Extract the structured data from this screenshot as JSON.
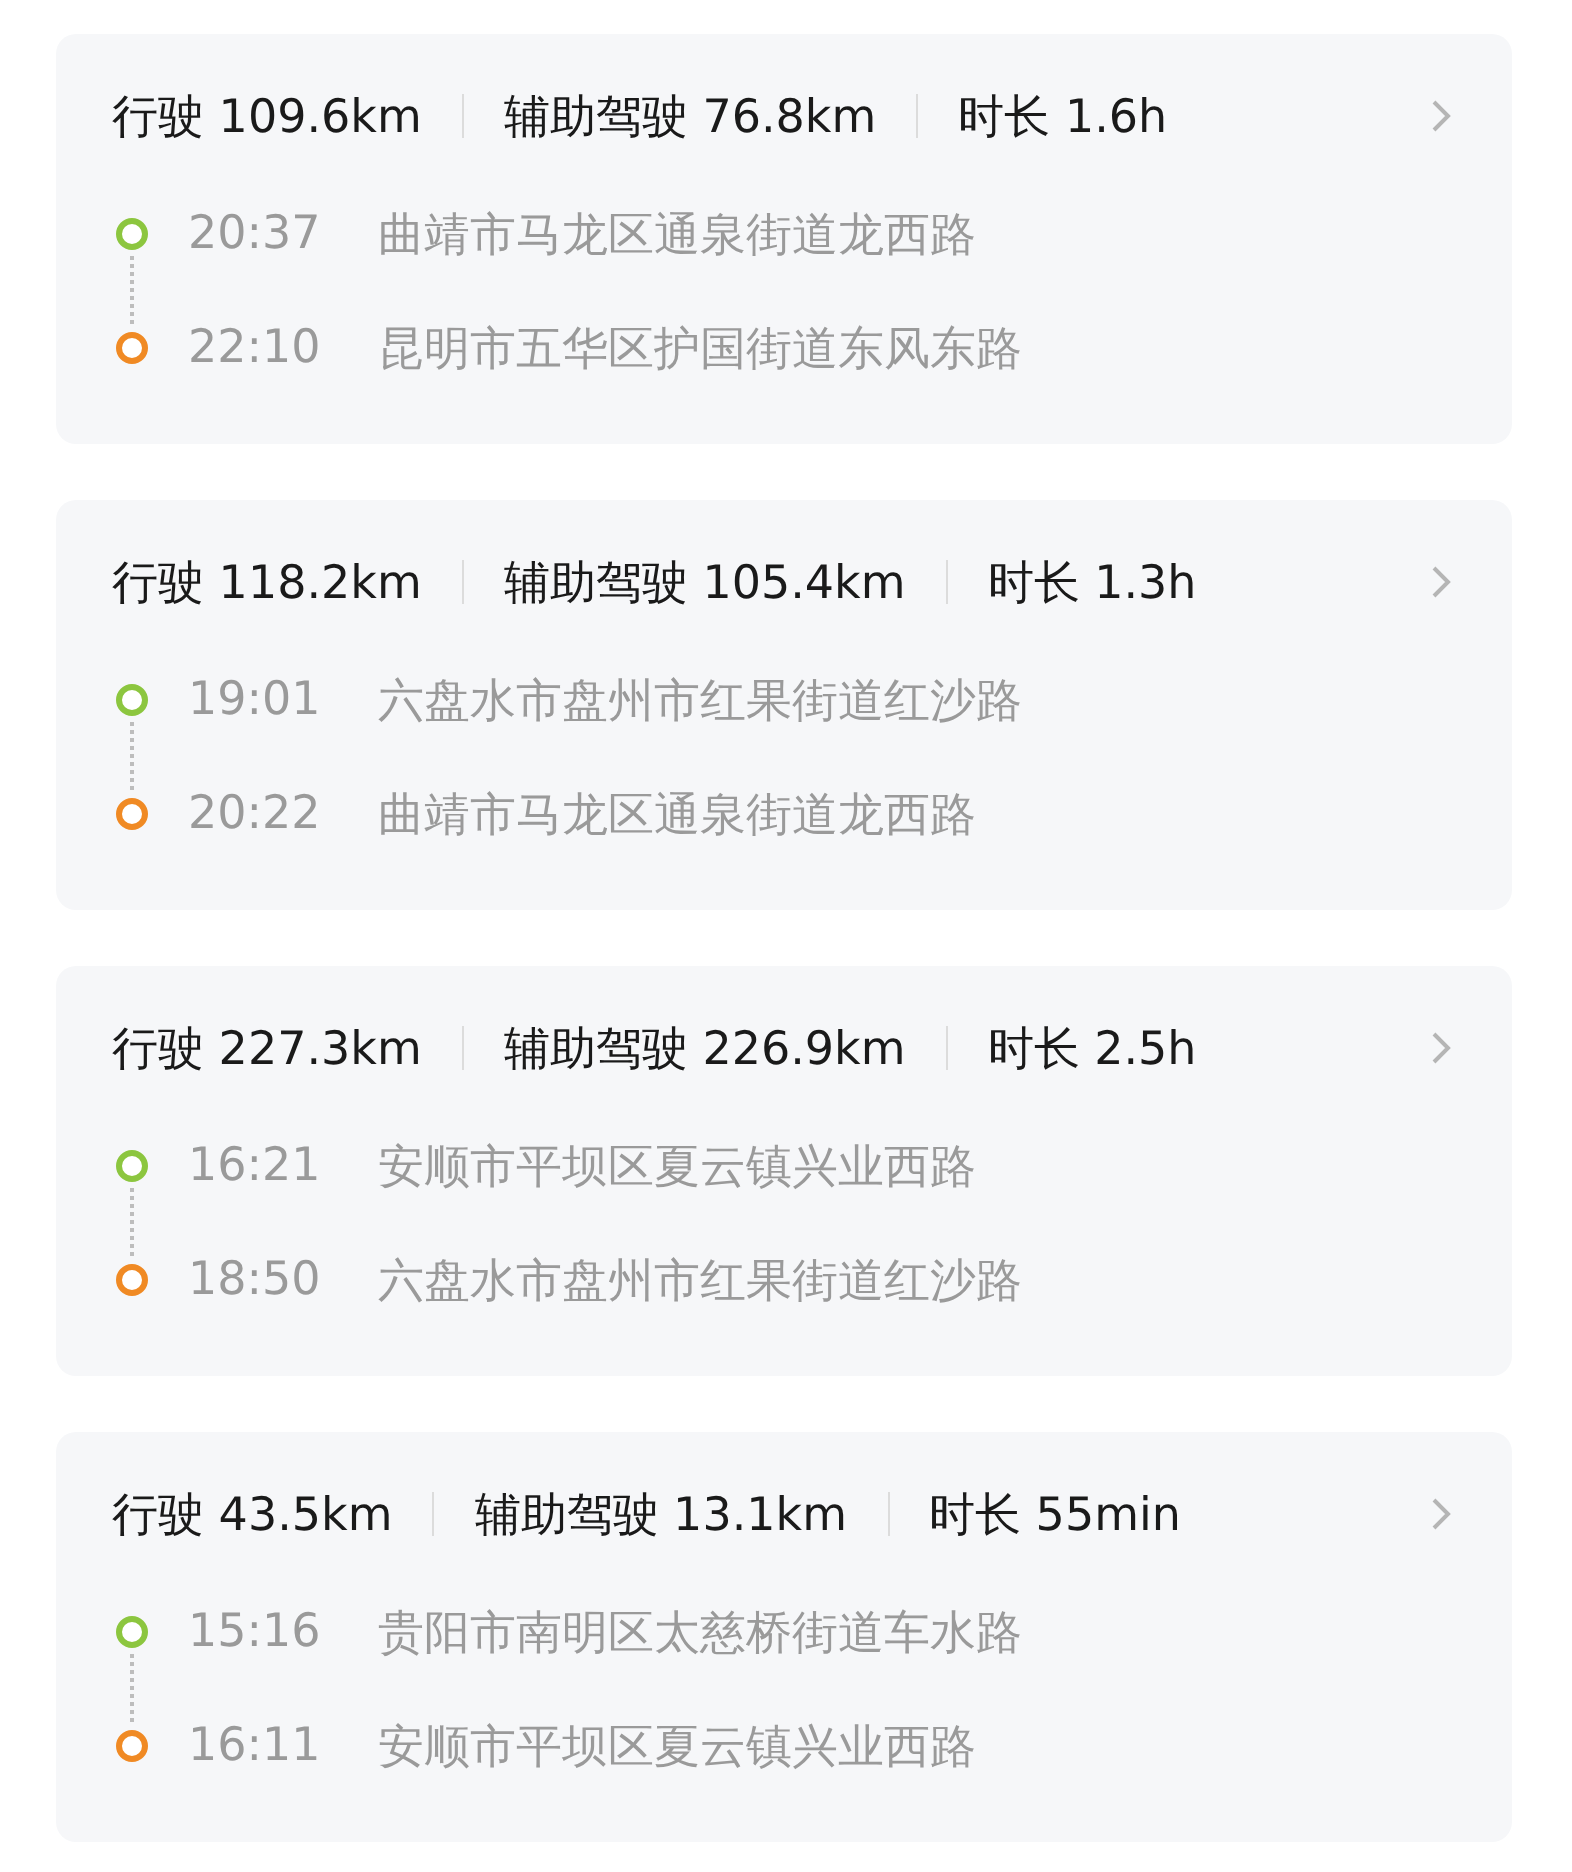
{
  "trips": [
    {
      "stats": [
        "行驶 109.6km",
        "辅助驾驶 76.8km",
        "时长 1.6h"
      ],
      "stops": [
        {
          "kind": "start",
          "time": "20:37",
          "place": "曲靖市马龙区通泉街道龙西路"
        },
        {
          "kind": "end",
          "time": "22:10",
          "place": "昆明市五华区护国街道东风东路"
        }
      ]
    },
    {
      "stats": [
        "行驶 118.2km",
        "辅助驾驶 105.4km",
        "时长 1.3h"
      ],
      "stops": [
        {
          "kind": "start",
          "time": "19:01",
          "place": "六盘水市盘州市红果街道红沙路"
        },
        {
          "kind": "end",
          "time": "20:22",
          "place": "曲靖市马龙区通泉街道龙西路"
        }
      ]
    },
    {
      "stats": [
        "行驶 227.3km",
        "辅助驾驶 226.9km",
        "时长 2.5h"
      ],
      "stops": [
        {
          "kind": "start",
          "time": "16:21",
          "place": "安顺市平坝区夏云镇兴业西路"
        },
        {
          "kind": "end",
          "time": "18:50",
          "place": "六盘水市盘州市红果街道红沙路"
        }
      ]
    },
    {
      "stats": [
        "行驶 43.5km",
        "辅助驾驶 13.1km",
        "时长 55min"
      ],
      "stops": [
        {
          "kind": "start",
          "time": "15:16",
          "place": "贵阳市南明区太慈桥街道车水路"
        },
        {
          "kind": "end",
          "time": "16:11",
          "place": "安顺市平坝区夏云镇兴业西路"
        }
      ]
    }
  ]
}
